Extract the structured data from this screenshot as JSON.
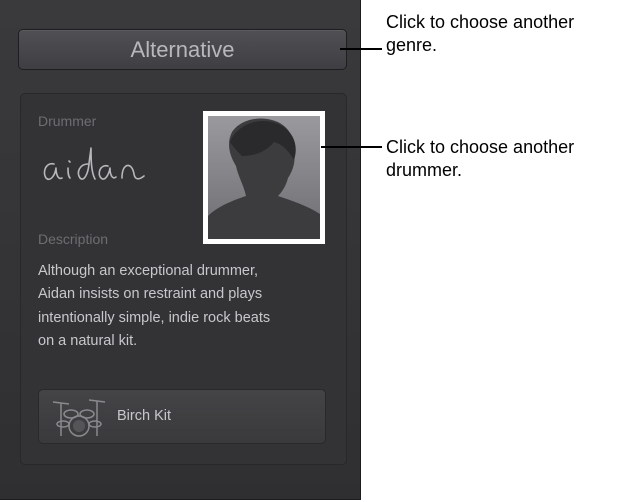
{
  "genre_button": {
    "label": "Alternative"
  },
  "drummer": {
    "section_label": "Drummer",
    "signature_name": "aidan",
    "description_label": "Description",
    "description_lines": [
      "Although an exceptional drummer,",
      "Aidan insists on restraint and plays",
      "intentionally simple, indie rock beats",
      "on a natural kit."
    ]
  },
  "kit_button": {
    "label": "Birch Kit",
    "icon": "drum-kit-icon"
  },
  "callouts": [
    {
      "lines": [
        "Click to choose another",
        "genre."
      ]
    },
    {
      "lines": [
        "Click to choose another",
        "drummer."
      ]
    }
  ],
  "colors": {
    "panel": "#333336",
    "label": "#6e6e72",
    "text": "#c8c8cc",
    "callout_line": "#000000"
  }
}
